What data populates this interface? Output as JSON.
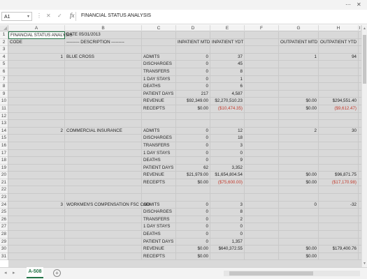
{
  "window": {
    "controls": [
      "⋯",
      "✕"
    ]
  },
  "formula_bar": {
    "name_box": "A1",
    "fx_label": "fx",
    "content": "FINANCIAL STATUS ANALYSIS"
  },
  "columns": [
    "A",
    "B",
    "C",
    "D",
    "E",
    "F",
    "G",
    "H",
    "I"
  ],
  "rows": [
    {
      "n": "1",
      "cells": [
        "FINANCIAL STATUS ANALYSIS",
        "DATE 05/31/2013",
        "",
        "",
        "",
        "",
        "",
        "",
        ""
      ]
    },
    {
      "n": "2",
      "cells": [
        "CODE",
        "--------- DESCRIPTION ---------",
        "",
        "INPATIENT MTD",
        "INPATIENT YDT",
        "",
        "OUTPATIENT MTD",
        "OUTPATIENT YTD",
        ""
      ]
    },
    {
      "n": "3",
      "cells": [
        "",
        "",
        "",
        "",
        "",
        "",
        "",
        "",
        ""
      ]
    },
    {
      "n": "4",
      "cells": [
        "1",
        "BLUE CROSS",
        "ADMITS",
        "0",
        "37",
        "",
        "1",
        "94",
        ""
      ]
    },
    {
      "n": "5",
      "cells": [
        "",
        "",
        "DISCHARGES",
        "0",
        "45",
        "",
        "",
        "",
        ""
      ]
    },
    {
      "n": "6",
      "cells": [
        "",
        "",
        "TRANSFERS",
        "0",
        "8",
        "",
        "",
        "",
        ""
      ]
    },
    {
      "n": "7",
      "cells": [
        "",
        "",
        "1 DAY STAYS",
        "0",
        "1",
        "",
        "",
        "",
        ""
      ]
    },
    {
      "n": "8",
      "cells": [
        "",
        "",
        "DEATHS",
        "0",
        "6",
        "",
        "",
        "",
        ""
      ]
    },
    {
      "n": "9",
      "cells": [
        "",
        "",
        "PATIENT DAYS",
        "217",
        "4,587",
        "",
        "",
        "",
        ""
      ]
    },
    {
      "n": "10",
      "cells": [
        "",
        "",
        "REVENUE",
        "$92,349.00",
        "$2,270,510.23",
        "",
        "$0.00",
        "$294,551.40",
        ""
      ]
    },
    {
      "n": "11",
      "cells": [
        "",
        "",
        "RECEIPTS",
        "$0.00",
        "($10,474.35)",
        "",
        "$0.00",
        "($9,612.47)",
        ""
      ]
    },
    {
      "n": "12",
      "cells": [
        "",
        "",
        "",
        "",
        "",
        "",
        "",
        "",
        ""
      ]
    },
    {
      "n": "13",
      "cells": [
        "",
        "",
        "",
        "",
        "",
        "",
        "",
        "",
        ""
      ]
    },
    {
      "n": "14",
      "cells": [
        "2",
        "COMMERCIAL INSURANCE",
        "ADMITS",
        "0",
        "12",
        "",
        "2",
        "30",
        ""
      ]
    },
    {
      "n": "15",
      "cells": [
        "",
        "",
        "DISCHARGES",
        "0",
        "18",
        "",
        "",
        "",
        ""
      ]
    },
    {
      "n": "16",
      "cells": [
        "",
        "",
        "TRANSFERS",
        "0",
        "3",
        "",
        "",
        "",
        ""
      ]
    },
    {
      "n": "17",
      "cells": [
        "",
        "",
        "1 DAY STAYS",
        "0",
        "0",
        "",
        "",
        "",
        ""
      ]
    },
    {
      "n": "18",
      "cells": [
        "",
        "",
        "DEATHS",
        "0",
        "9",
        "",
        "",
        "",
        ""
      ]
    },
    {
      "n": "19",
      "cells": [
        "",
        "",
        "PATIENT DAYS",
        "62",
        "3,352",
        "",
        "",
        "",
        ""
      ]
    },
    {
      "n": "20",
      "cells": [
        "",
        "",
        "REVENUE",
        "$21,979.00",
        "$1,654,804.54",
        "",
        "$0.00",
        "$96,871.75",
        ""
      ]
    },
    {
      "n": "21",
      "cells": [
        "",
        "",
        "RECEIPTS",
        "$0.00",
        "($75,600.00)",
        "",
        "$0.00",
        "($17,170.98)",
        ""
      ]
    },
    {
      "n": "22",
      "cells": [
        "",
        "",
        "",
        "",
        "",
        "",
        "",
        "",
        ""
      ]
    },
    {
      "n": "23",
      "cells": [
        "",
        "",
        "",
        "",
        "",
        "",
        "",
        "",
        ""
      ]
    },
    {
      "n": "24",
      "cells": [
        "3",
        "WORKMEN'S COMPENSATION FSC COD",
        "ADMITS",
        "0",
        "3",
        "",
        "0",
        "-32",
        ""
      ]
    },
    {
      "n": "25",
      "cells": [
        "",
        "",
        "DISCHARGES",
        "0",
        "8",
        "",
        "",
        "",
        ""
      ]
    },
    {
      "n": "26",
      "cells": [
        "",
        "",
        "TRANSFERS",
        "0",
        "2",
        "",
        "",
        "",
        ""
      ]
    },
    {
      "n": "27",
      "cells": [
        "",
        "",
        "1 DAY STAYS",
        "0",
        "0",
        "",
        "",
        "",
        ""
      ]
    },
    {
      "n": "28",
      "cells": [
        "",
        "",
        "DEATHS",
        "0",
        "0",
        "",
        "",
        "",
        ""
      ]
    },
    {
      "n": "29",
      "cells": [
        "",
        "",
        "PATIENT DAYS",
        "0",
        "1,357",
        "",
        "",
        "",
        ""
      ]
    },
    {
      "n": "30",
      "cells": [
        "",
        "",
        "REVENUE",
        "$0.00",
        "$640,372.55",
        "",
        "$0.00",
        "$179,400.76",
        ""
      ]
    },
    {
      "n": "31",
      "cells": [
        "",
        "",
        "RECEIPTS",
        "$0.00",
        "",
        "",
        "$0.00",
        "",
        ""
      ]
    }
  ],
  "sheet_tabs": [
    "A-508"
  ],
  "colors": {
    "accent": "#217346",
    "negative": "#c0392b",
    "grid": "#d9d9d9"
  }
}
